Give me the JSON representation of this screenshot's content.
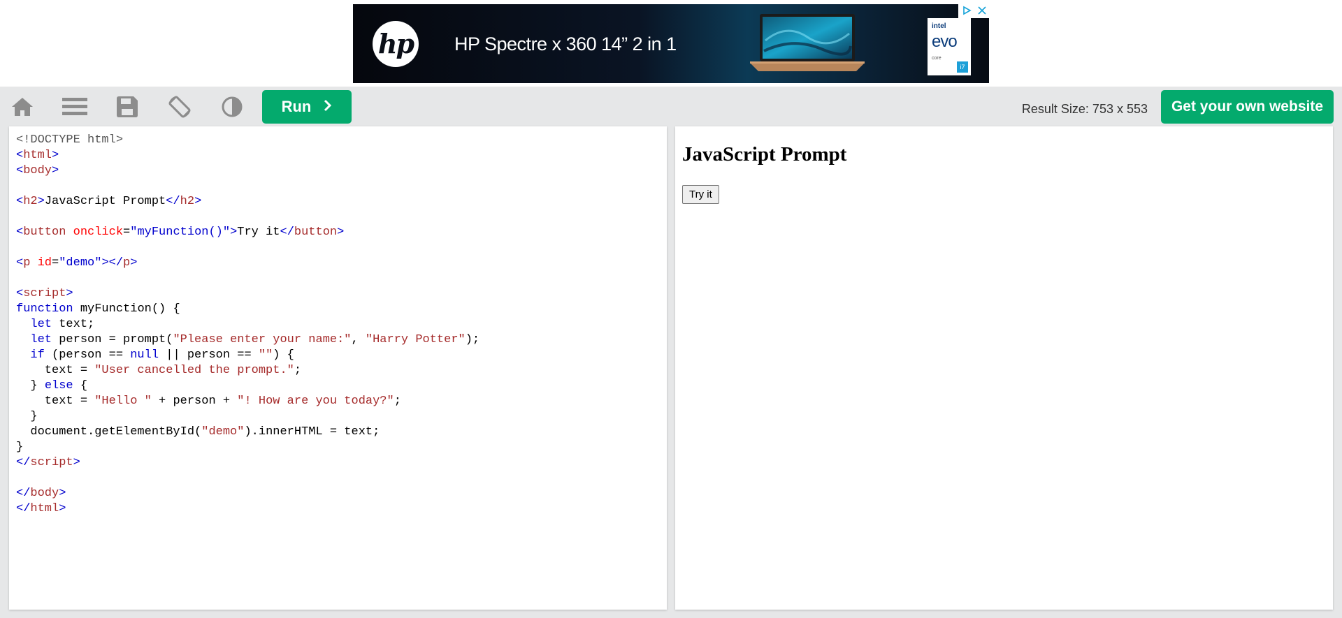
{
  "ad": {
    "logo_text": "hp",
    "headline": "HP Spectre x 360 14” 2 in 1",
    "intel_brand": "intel",
    "intel_evo": "evo",
    "intel_core": "core",
    "intel_gen": "i7",
    "choices_icon": "adchoices-icon",
    "close_icon": "close-icon"
  },
  "toolbar": {
    "icons": [
      "home-icon",
      "menu-icon",
      "save-icon",
      "rotate-icon",
      "contrast-icon"
    ],
    "run_label": "Run",
    "run_icon": "chevron-right-icon",
    "result_size": "Result Size: 753 x 553",
    "get_website_label": "Get your own website",
    "accent_color": "#04aa6d"
  },
  "code": {
    "lines": [
      [
        [
          "doctype",
          "<!DOCTYPE html>"
        ]
      ],
      [
        [
          "bracket",
          "<"
        ],
        [
          "tag",
          "html"
        ],
        [
          "bracket",
          ">"
        ]
      ],
      [
        [
          "bracket",
          "<"
        ],
        [
          "tag",
          "body"
        ],
        [
          "bracket",
          ">"
        ]
      ],
      [],
      [
        [
          "bracket",
          "<"
        ],
        [
          "tag",
          "h2"
        ],
        [
          "bracket",
          ">"
        ],
        [
          "plain",
          "JavaScript Prompt"
        ],
        [
          "bracket",
          "</"
        ],
        [
          "tag",
          "h2"
        ],
        [
          "bracket",
          ">"
        ]
      ],
      [],
      [
        [
          "bracket",
          "<"
        ],
        [
          "tag",
          "button"
        ],
        [
          "plain",
          " "
        ],
        [
          "attr",
          "onclick"
        ],
        [
          "plain",
          "="
        ],
        [
          "attrval",
          "\"myFunction()\""
        ],
        [
          "bracket",
          ">"
        ],
        [
          "plain",
          "Try it"
        ],
        [
          "bracket",
          "</"
        ],
        [
          "tag",
          "button"
        ],
        [
          "bracket",
          ">"
        ]
      ],
      [],
      [
        [
          "bracket",
          "<"
        ],
        [
          "tag",
          "p"
        ],
        [
          "plain",
          " "
        ],
        [
          "attr",
          "id"
        ],
        [
          "plain",
          "="
        ],
        [
          "attrval",
          "\"demo\""
        ],
        [
          "bracket",
          "></"
        ],
        [
          "tag",
          "p"
        ],
        [
          "bracket",
          ">"
        ]
      ],
      [],
      [
        [
          "bracket",
          "<"
        ],
        [
          "tag",
          "script"
        ],
        [
          "bracket",
          ">"
        ]
      ],
      [
        [
          "kw",
          "function"
        ],
        [
          "plain",
          " myFunction() {"
        ]
      ],
      [
        [
          "plain",
          "  "
        ],
        [
          "kw",
          "let"
        ],
        [
          "plain",
          " text;"
        ]
      ],
      [
        [
          "plain",
          "  "
        ],
        [
          "kw",
          "let"
        ],
        [
          "plain",
          " person = prompt("
        ],
        [
          "str",
          "\"Please enter your name:\""
        ],
        [
          "plain",
          ", "
        ],
        [
          "str",
          "\"Harry Potter\""
        ],
        [
          "plain",
          ");"
        ]
      ],
      [
        [
          "plain",
          "  "
        ],
        [
          "kw",
          "if"
        ],
        [
          "plain",
          " (person == "
        ],
        [
          "kw",
          "null"
        ],
        [
          "plain",
          " || person == "
        ],
        [
          "str",
          "\"\""
        ],
        [
          "plain",
          ") {"
        ]
      ],
      [
        [
          "plain",
          "    text = "
        ],
        [
          "str",
          "\"User cancelled the prompt.\""
        ],
        [
          "plain",
          ";"
        ]
      ],
      [
        [
          "plain",
          "  } "
        ],
        [
          "kw",
          "else"
        ],
        [
          "plain",
          " {"
        ]
      ],
      [
        [
          "plain",
          "    text = "
        ],
        [
          "str",
          "\"Hello \""
        ],
        [
          "plain",
          " + person + "
        ],
        [
          "str",
          "\"! How are you today?\""
        ],
        [
          "plain",
          ";"
        ]
      ],
      [
        [
          "plain",
          "  }"
        ]
      ],
      [
        [
          "plain",
          "  document.getElementById("
        ],
        [
          "str",
          "\"demo\""
        ],
        [
          "plain",
          ").innerHTML = text;"
        ]
      ],
      [
        [
          "plain",
          "}"
        ]
      ],
      [
        [
          "bracket",
          "</"
        ],
        [
          "tag",
          "script"
        ],
        [
          "bracket",
          ">"
        ]
      ],
      [],
      [
        [
          "bracket",
          "</"
        ],
        [
          "tag",
          "body"
        ],
        [
          "bracket",
          ">"
        ]
      ],
      [
        [
          "bracket",
          "</"
        ],
        [
          "tag",
          "html"
        ],
        [
          "bracket",
          ">"
        ]
      ]
    ]
  },
  "result": {
    "heading": "JavaScript Prompt",
    "button_label": "Try it"
  }
}
